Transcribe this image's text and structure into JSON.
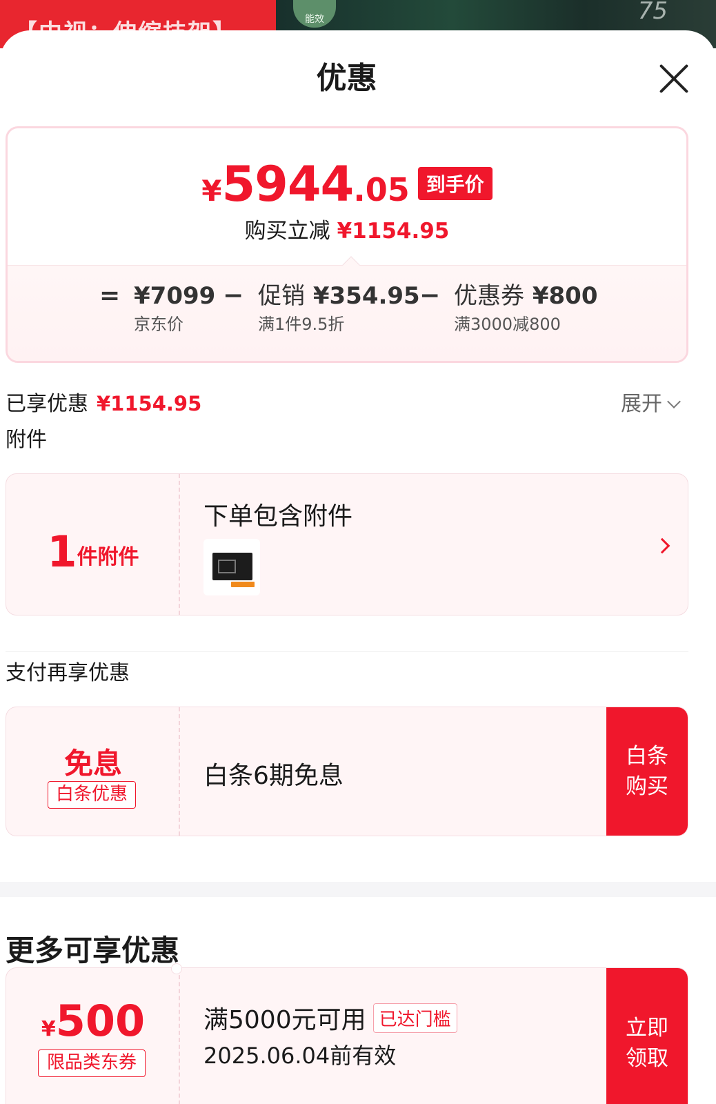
{
  "colors": {
    "accent": "#f0172c",
    "card_bg": "#fff5f6",
    "border": "#f5dde2"
  },
  "banner": {
    "text": "【中视：伸缩技架】",
    "badge": "能效",
    "number": "75"
  },
  "sheet": {
    "title": "优惠",
    "close_icon": "close-icon"
  },
  "summary": {
    "currency": "¥",
    "price_int": "5944",
    "price_dec": ".05",
    "tag": "到手价",
    "reduce_label": "购买立减",
    "reduce_amount": "¥1154.95",
    "breakdown": {
      "eq": "=",
      "base_value": "¥7099",
      "base_label": "京东价",
      "minus1": "−",
      "promo_label": "促销",
      "promo_value": "¥354.95",
      "promo_sub": "满1件9.5折",
      "minus2": "−",
      "coupon_label": "优惠券",
      "coupon_value": "¥800",
      "coupon_sub": "满3000减800"
    }
  },
  "enjoyed": {
    "label": "已享优惠",
    "amount": "¥1154.95",
    "expand": "展开"
  },
  "attachments": {
    "section": "附件",
    "count": "1",
    "unit": "件附件",
    "title": "下单包含附件"
  },
  "payment": {
    "section": "支付再享优惠",
    "big": "免息",
    "tag": "白条优惠",
    "desc": "白条6期免息",
    "button": "白条\n购买"
  },
  "more": {
    "title": "更多可享优惠",
    "coupon": {
      "currency": "¥",
      "amount": "500",
      "tag": "限品类东券",
      "condition": "满5000元可用",
      "badge": "已达门槛",
      "valid": "2025.06.04前有效",
      "button": "立即\n领取"
    }
  }
}
